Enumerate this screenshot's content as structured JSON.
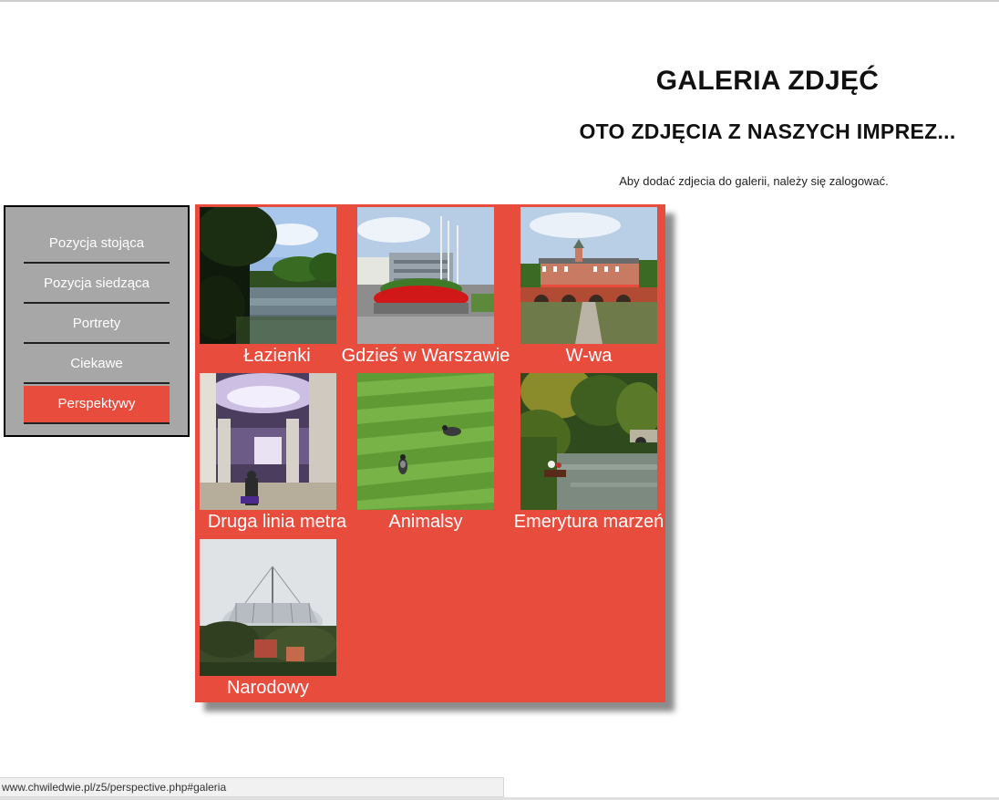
{
  "header": {
    "title": "GALERIA ZDJĘĆ",
    "subtitle": "OTO ZDJĘCIA Z NASZYCH IMPREZ...",
    "login_note": "Aby dodać zdjecia do galerii, należy się zalogować."
  },
  "sidebar": {
    "items": [
      {
        "label": "Pozycja stojąca",
        "active": false
      },
      {
        "label": "Pozycja siedząca",
        "active": false
      },
      {
        "label": "Portrety",
        "active": false
      },
      {
        "label": "Ciekawe",
        "active": false
      },
      {
        "label": "Perspektywy",
        "active": true
      }
    ]
  },
  "gallery": {
    "items": [
      {
        "caption": "Łazienki",
        "photo": "lake-park-photo"
      },
      {
        "caption": "Gdzieś w Warszawie",
        "photo": "city-flowerbed-photo"
      },
      {
        "caption": "W-wa",
        "photo": "royal-castle-photo"
      },
      {
        "caption": "Druga linia metra",
        "photo": "metro-station-photo"
      },
      {
        "caption": "Animalsy",
        "photo": "birds-on-grass-photo"
      },
      {
        "caption": "Emerytura marzeń",
        "photo": "river-boat-photo"
      },
      {
        "caption": "Narodowy",
        "photo": "national-stadium-photo"
      }
    ]
  },
  "status_bar": {
    "url": "www.chwiledwie.pl/z5/perspective.php#galeria"
  },
  "colors": {
    "accent": "#e74c3c",
    "sidebar_bg": "#a7a7a7"
  }
}
